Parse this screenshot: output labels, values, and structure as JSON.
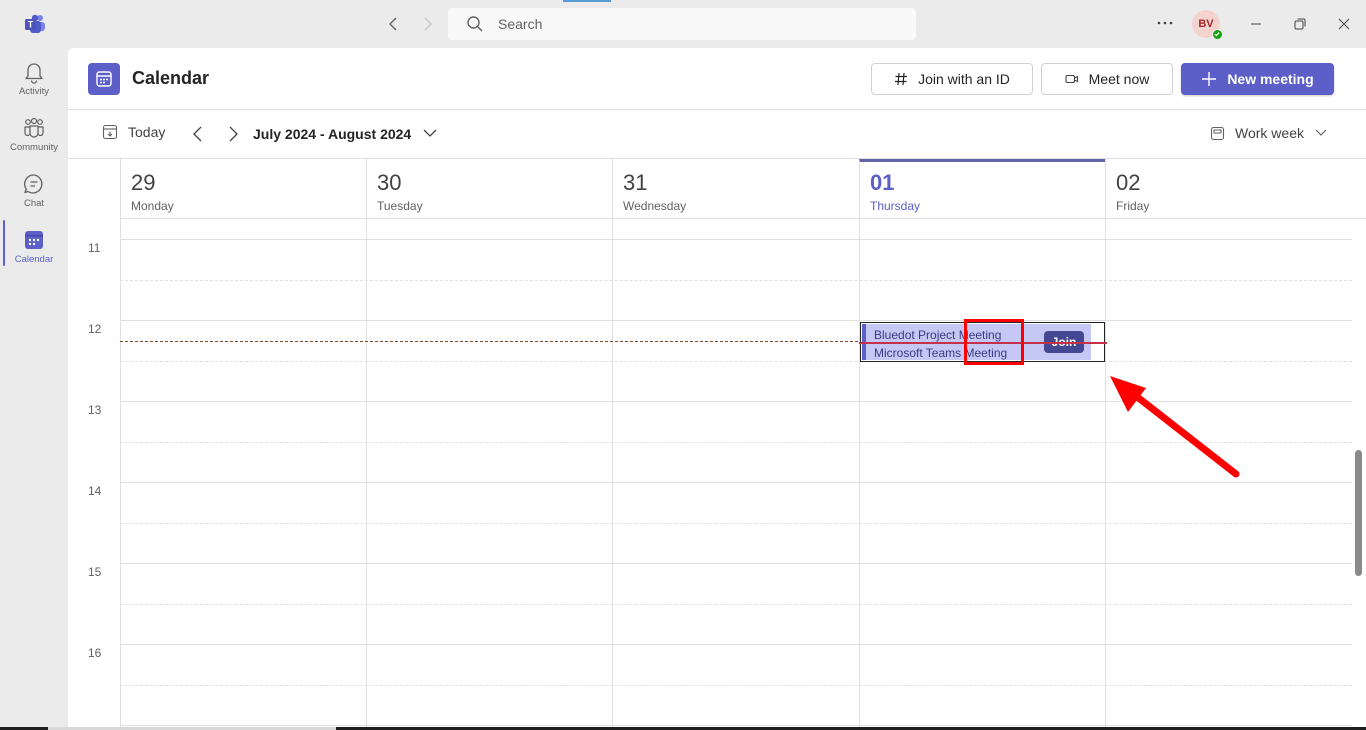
{
  "titlebar": {
    "app_icon": "teams-logo-icon",
    "back_icon": "chevron-left-icon",
    "forward_icon": "chevron-right-icon",
    "search": {
      "placeholder": "Search",
      "value": "",
      "icon": "search-icon"
    },
    "more_icon": "more-horizontal-icon",
    "avatar": {
      "initials": "BV",
      "presence": "available",
      "presence_color": "#13a10e"
    },
    "window_controls": [
      "minimize",
      "restore",
      "close"
    ]
  },
  "rail": {
    "items": [
      {
        "label": "Activity",
        "icon": "bell-icon",
        "active": false
      },
      {
        "label": "Community",
        "icon": "community-icon",
        "active": false
      },
      {
        "label": "Chat",
        "icon": "chat-icon",
        "active": false
      },
      {
        "label": "Calendar",
        "icon": "calendar-icon",
        "active": true
      }
    ]
  },
  "header": {
    "title": "Calendar",
    "join_with_id_label": "Join with an ID",
    "meet_now_label": "Meet now",
    "new_meeting_label": "New meeting"
  },
  "toolbar": {
    "today_label": "Today",
    "date_range": "July 2024 - August 2024",
    "view_label": "Work week"
  },
  "week": {
    "days": [
      {
        "number": "29",
        "name": "Monday",
        "today": false
      },
      {
        "number": "30",
        "name": "Tuesday",
        "today": false
      },
      {
        "number": "31",
        "name": "Wednesday",
        "today": false
      },
      {
        "number": "01",
        "name": "Thursday",
        "today": true
      },
      {
        "number": "02",
        "name": "Friday",
        "today": false
      }
    ],
    "hours": [
      "11",
      "12",
      "13",
      "14",
      "15",
      "16"
    ]
  },
  "events": [
    {
      "title": "Bluedot Project Meeting",
      "subtitle": "Microsoft Teams Meeting",
      "day": "01",
      "join_label": "Join"
    }
  ],
  "colors": {
    "accent": "#5b5fc7",
    "event_fill": "#c5c7f5",
    "join_button": "#444791",
    "annotation": "#ff0000",
    "current_time": "#c4314b"
  }
}
